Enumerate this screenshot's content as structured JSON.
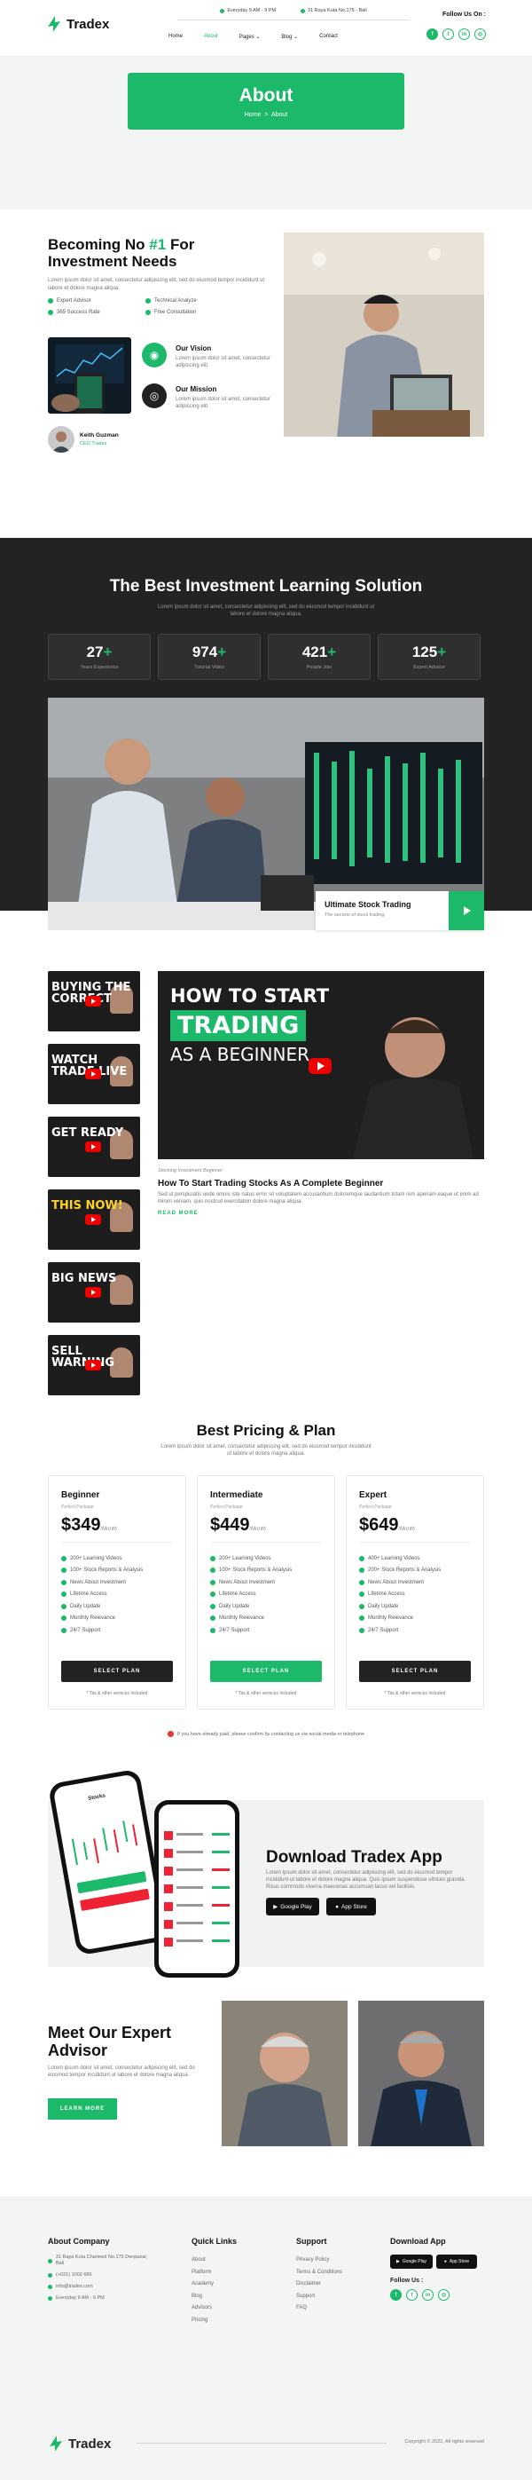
{
  "brand": {
    "name": "Tradex",
    "accent": "#1cb96a",
    "dark": "#232323"
  },
  "topbar": {
    "hours": "Everyday 9 AM - 9 PM",
    "address": "31 Raya Kuta No.175 - Bali",
    "follow": "Follow Us On :"
  },
  "nav": [
    "Home",
    "About",
    "Pages",
    "Blog",
    "Contact"
  ],
  "hero": {
    "title": "About",
    "crumb_home": "Home",
    "crumb_sep": ">",
    "crumb_current": "About"
  },
  "about": {
    "title_a": "Becoming No ",
    "title_num": "#1",
    "title_b": " For Investment Needs",
    "desc": "Lorem ipsum dolor sit amet, consectetur adipiscing elit, sed do eiusmod tempor incididunt ut labore et dolore magna aliqua.",
    "checks": [
      "Expert Advisor",
      "Technical Analyze",
      "365 Success Rate",
      "Free Consultation"
    ],
    "vision_title": "Our Vision",
    "vision_text": "Lorem ipsum dolor sit amet, consectetur adipiscing elit.",
    "mission_title": "Our Mission",
    "mission_text": "Lorem ipsum dolor sit amet, consectetur adipiscing elit.",
    "author_name": "Keith Guzman",
    "author_role": "CEO Tradex"
  },
  "learning": {
    "title": "The Best Investment Learning Solution",
    "desc": "Lorem ipsum dolor sit amet, consectetur adipiscing elit, sed do eiusmod tempor incididunt ut labore et dolore magna aliqua.",
    "stats": [
      {
        "value": "27",
        "label": "Years Experience"
      },
      {
        "value": "974",
        "label": "Tutorial Video"
      },
      {
        "value": "421",
        "label": "People Join"
      },
      {
        "value": "125",
        "label": "Expert Advisor"
      }
    ],
    "caption_title": "Ultimate Stock Trading",
    "caption_sub": "The secrets of stock trading"
  },
  "videos": {
    "thumbs": [
      "BUYING THE CORRECT",
      "WATCH TRADE LIVE",
      "GET READY",
      "THIS NOW!",
      "BIG NEWS",
      "SELL WARNING"
    ],
    "main_line1": "HOW TO START",
    "main_line2": "TRADING",
    "main_line3": "AS A BEGINNER",
    "tag": "Stocking Investment Beginner",
    "title": "How To Start Trading Stocks As A Complete Beginner",
    "desc": "Sed ut perspiciatis unde omnis iste natus error sit voluptatem accusantium doloremque laudantium totam rem aperiam eaque ut enim ad minim veniam, quis nostrud exercitation dolore magna aliqua.",
    "more": "READ MORE"
  },
  "pricing": {
    "title": "Best Pricing & Plan",
    "desc": "Lorem ipsum dolor sit amet, consectetur adipiscing elit, sed do eiusmod tempor incididunt ut labore et dolore magna aliqua.",
    "plans": [
      {
        "name": "Beginner",
        "sub": "Perfect Package",
        "price": "$349",
        "period": "/Month",
        "features": [
          "200+ Learning Videos",
          "100+ Stock Reports & Analysis",
          "News About Investment",
          "Lifetime Access",
          "Daily Update",
          "Monthly Relevance",
          "24/7 Support"
        ],
        "button": "SELECT PLAN",
        "foot": "* Tax & other services Included"
      },
      {
        "name": "Intermediate",
        "sub": "Perfect Package",
        "price": "$449",
        "period": "/Month",
        "features": [
          "200+ Learning Videos",
          "100+ Stock Reports & Analysis",
          "News About Investment",
          "Lifetime Access",
          "Daily Update",
          "Monthly Relevance",
          "24/7 Support"
        ],
        "button": "SELECT PLAN",
        "foot": "* Tax & other services Included"
      },
      {
        "name": "Expert",
        "sub": "Perfect Package",
        "price": "$649",
        "period": "/Month",
        "features": [
          "400+ Learning Videos",
          "200+ Stock Reports & Analysis",
          "News About Investment",
          "Lifetime Access",
          "Daily Update",
          "Monthly Relevance",
          "24/7 Support"
        ],
        "button": "SELECT PLAN",
        "foot": "* Tax & other services Included"
      }
    ],
    "note": "If you have already paid, please confirm by contacting us via social media or telephone"
  },
  "app": {
    "title": "Download Tradex App",
    "desc": "Lorem ipsum dolor sit amet, consectetur adipiscing elit, sed do eiusmod tempor incididunt ut labore et dolore magna aliqua. Quis ipsum suspendisse ultrices gravida. Risus commodo viverra maecenas accumsan lacus vel facilisis.",
    "google": "Google Play",
    "apple": "App Store",
    "screen_title": "Stocks"
  },
  "expert": {
    "title": "Meet Our Expert Advisor",
    "desc": "Lorem ipsum dolor sit amet, consectetur adipiscing elit, sed do eiusmod tempor incididunt ut labore et dolore magna aliqua.",
    "button": "LEARN MORE"
  },
  "footer": {
    "about_title": "About Company",
    "address": "31 Raya Kuta Charteed No.175 Denpasar, Bali",
    "phone": "(+021) 1002 686",
    "email": "info@tradex.com",
    "hours": "Everyday 9 AM - 9 PM",
    "links_title": "Quick Links",
    "links": [
      "About",
      "Platform",
      "Academy",
      "Blog",
      "Advisors",
      "Pricing"
    ],
    "support_title": "Support",
    "support": [
      "Privacy Policy",
      "Terms & Conditions",
      "Disclaimer",
      "Support",
      "FAQ"
    ],
    "download_title": "Download App",
    "follow": "Follow Us :",
    "copyright": "Copyright © 2022, All rights reserved"
  }
}
